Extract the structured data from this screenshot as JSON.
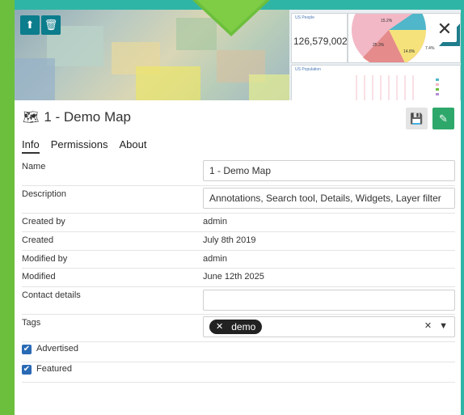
{
  "thumbnail": {
    "upload_icon": "upload-icon",
    "delete_icon": "trash-icon",
    "close_icon": "close-icon",
    "widget_population_title": "US People",
    "widget_population_value": "126,579,002",
    "widget_chart_title": "US Population",
    "pie_labels": [
      "15.2%",
      "25.3%",
      "14.8%",
      "7.4%"
    ]
  },
  "header": {
    "title": "1 - Demo Map",
    "title_icon": "map-icon",
    "save_icon": "save-icon",
    "edit_icon": "edit-icon"
  },
  "tabs": [
    {
      "label": "Info",
      "active": true
    },
    {
      "label": "Permissions",
      "active": false
    },
    {
      "label": "About",
      "active": false
    }
  ],
  "info": {
    "name_label": "Name",
    "name_value": "1 - Demo Map",
    "description_label": "Description",
    "description_value": "Annotations, Search tool, Details, Widgets, Layer filter",
    "created_by_label": "Created by",
    "created_by_value": "admin",
    "created_label": "Created",
    "created_value": "July 8th 2019",
    "modified_by_label": "Modified by",
    "modified_by_value": "admin",
    "modified_label": "Modified",
    "modified_value": "June 12th 2025",
    "contact_label": "Contact details",
    "contact_value": "",
    "tags_label": "Tags",
    "tags": [
      "demo"
    ],
    "advertised_label": "Advertised",
    "advertised_checked": true,
    "featured_label": "Featured",
    "featured_checked": true
  },
  "colors": {
    "frame_green": "#6cbf3c",
    "frame_teal": "#2fb5a6",
    "edit_green": "#2ea86a",
    "thumb_button": "#0b7d8c",
    "checkbox": "#2a6ab5"
  }
}
